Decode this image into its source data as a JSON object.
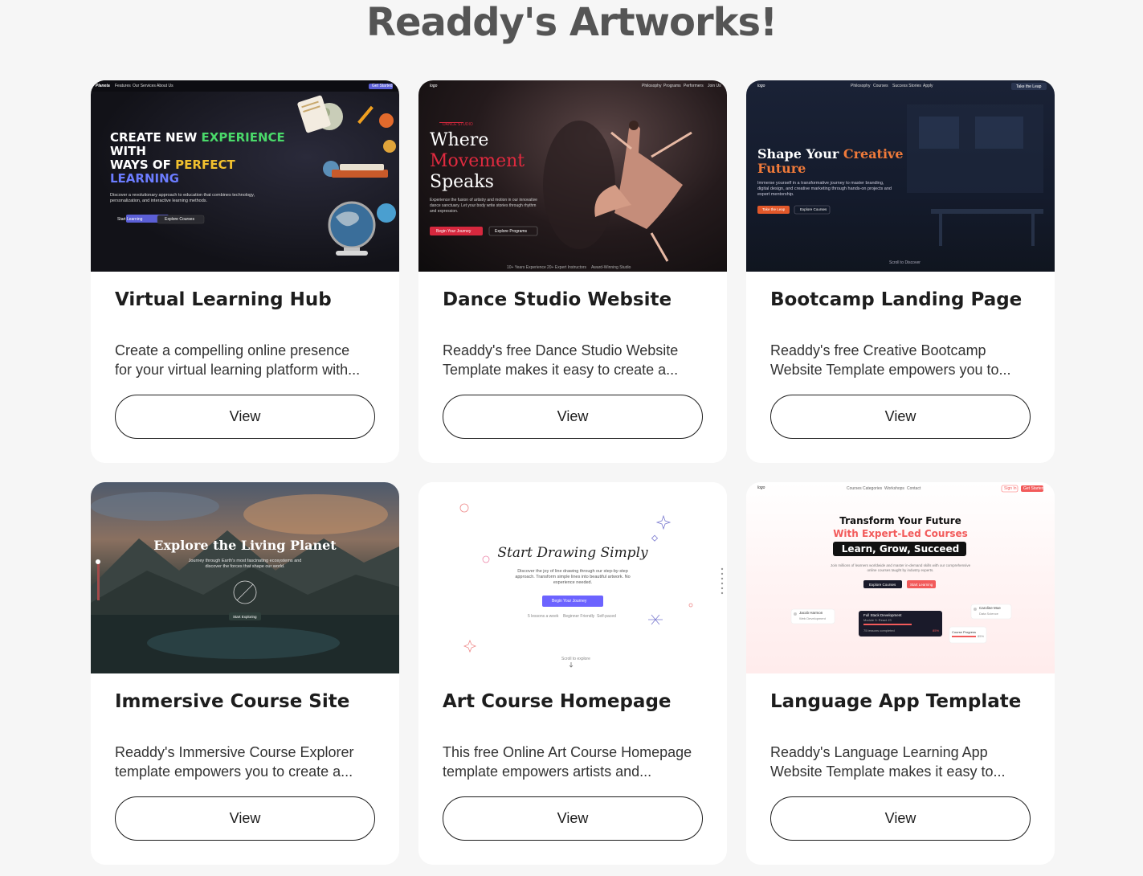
{
  "page": {
    "title": "Readdy's Artworks!"
  },
  "cards": [
    {
      "title": "Virtual Learning Hub",
      "desc_line1": "Create a compelling online presence",
      "desc_line2": "for your virtual learning platform with...",
      "button": "View",
      "thumb": {
        "logo": "Planeta",
        "nav": [
          "Features",
          "Our Services",
          "About Us"
        ],
        "cta": "Get Started",
        "headline": [
          "CREATE NEW",
          "EXPERIENCE",
          "WITH",
          "WAYS OF",
          "PERFECT",
          "LEARNING"
        ],
        "sub": "Discover a revolutionary approach to education that combines technology, personalization, and interactive learning methods.",
        "btn1": "Start Learning",
        "btn2": "Explore Courses"
      }
    },
    {
      "title": "Dance Studio Website",
      "desc_line1": "Readdy's free Dance Studio Website",
      "desc_line2": "Template makes it easy to create a...",
      "button": "View",
      "thumb": {
        "logo": "logo",
        "nav": [
          "Philosophy",
          "Programs",
          "Performers",
          "Join Us"
        ],
        "kicker": "DANCE STUDIO",
        "headline": [
          "Where",
          "Movement",
          "Speaks"
        ],
        "sub": "Experience the fusion of artistry and motion in our innovative dance sanctuary. Let your body write stories through rhythm and expression.",
        "btn1": "Begin Your Journey",
        "btn2": "Explore Programs",
        "stats": [
          "10+ Years Experience",
          "20+ Expert Instructors",
          "Award-Winning Studio"
        ]
      }
    },
    {
      "title": "Bootcamp Landing Page",
      "desc_line1": "Readdy's free Creative Bootcamp",
      "desc_line2": "Website Template empowers you to...",
      "button": "View",
      "thumb": {
        "logo": "logo",
        "nav": [
          "Philosophy",
          "Courses",
          "Success Stories",
          "Apply"
        ],
        "cta": "Take the Leap",
        "headline1": "Shape Your",
        "headline_accent1": "Creative",
        "headline_accent2": "Future",
        "sub": "Immerse yourself in a transformative journey to master branding, digital design, and creative marketing through hands-on projects and expert mentorship.",
        "btn1": "Take the Leap",
        "btn2": "Explore Courses",
        "scroll": "Scroll to Discover"
      }
    },
    {
      "title": "Immersive Course Site",
      "desc_line1": "Readdy's Immersive Course Explorer",
      "desc_line2": "template empowers you to create a...",
      "button": "View",
      "thumb": {
        "headline": "Explore the Living Planet",
        "sub": "Journey through Earth's most fascinating ecosystems and discover the forces that shape our world.",
        "btn": "Start Exploring"
      }
    },
    {
      "title": "Art Course Homepage",
      "desc_line1": "This free Online Art Course Homepage",
      "desc_line2": "template empowers artists and...",
      "button": "View",
      "thumb": {
        "headline": "Start Drawing Simply",
        "sub": "Discover the joy of line drawing through our step-by-step approach. Transform simple lines into beautiful artwork. No experience needed.",
        "btn": "Begin Your Journey",
        "features": [
          "5 lessons a week",
          "Beginner Friendly",
          "Self-paced"
        ],
        "scroll": "Scroll to explore"
      }
    },
    {
      "title": "Language App Template",
      "desc_line1": "Readdy's Language Learning App",
      "desc_line2": "Website Template makes it easy to...",
      "button": "View",
      "thumb": {
        "logo": "logo",
        "nav": [
          "Courses",
          "Categories",
          "Workshops",
          "Contact"
        ],
        "signin": "Sign In",
        "cta": "Get Started",
        "headline1": "Transform Your Future",
        "headline2": "With Expert-Led Courses",
        "headline3": "Learn, Grow, Succeed",
        "sub": "Join millions of learners worldwide and master in-demand skills with our comprehensive online courses taught by industry experts.",
        "btn1": "Explore Courses",
        "btn2": "Start Learning",
        "card1_name": "Jacob Harmon",
        "card1_role": "Web Development",
        "card2_name": "Caroline Moe",
        "card2_role": "Data Science",
        "center_title": "Full Stack Development",
        "center_sub": "Module 3: React JS",
        "center_status": "75 lessons completed",
        "center_pct": "85%",
        "progress_label": "Course Progress",
        "progress_pct": "85%"
      }
    }
  ]
}
